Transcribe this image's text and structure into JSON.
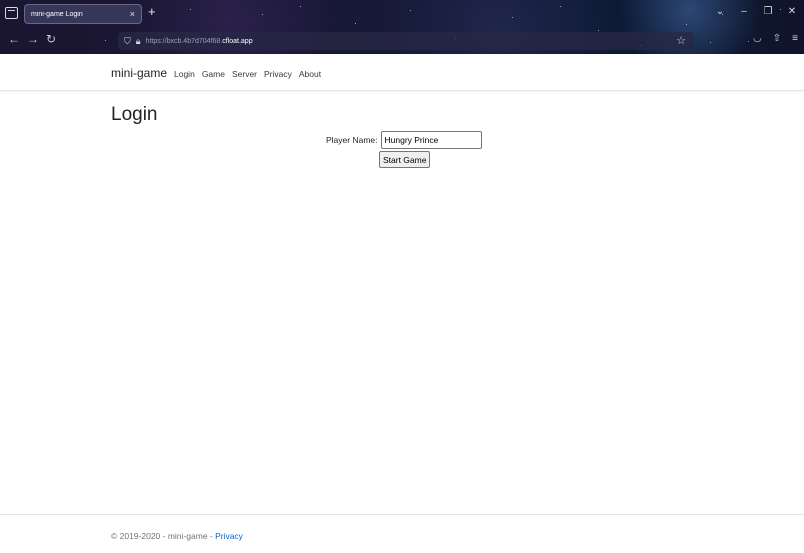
{
  "browser": {
    "tab_title": "mini-game Login",
    "tab_close": "×",
    "new_tab": "+",
    "url_prefix": "https://bxcb.4b7d704f68.",
    "url_domain": "cfloat.app",
    "window_controls": [
      "⌄",
      "–",
      "❐",
      "✕"
    ]
  },
  "site": {
    "brand": "mini-game",
    "nav": [
      "Login",
      "Game",
      "Server",
      "Privacy",
      "About"
    ]
  },
  "main": {
    "title": "Login",
    "player_label": "Player Name:",
    "player_value": "Hungry Prince",
    "start_button": "Start Game"
  },
  "footer": {
    "text": "© 2019-2020 - mini-game - ",
    "privacy_link": "Privacy"
  }
}
